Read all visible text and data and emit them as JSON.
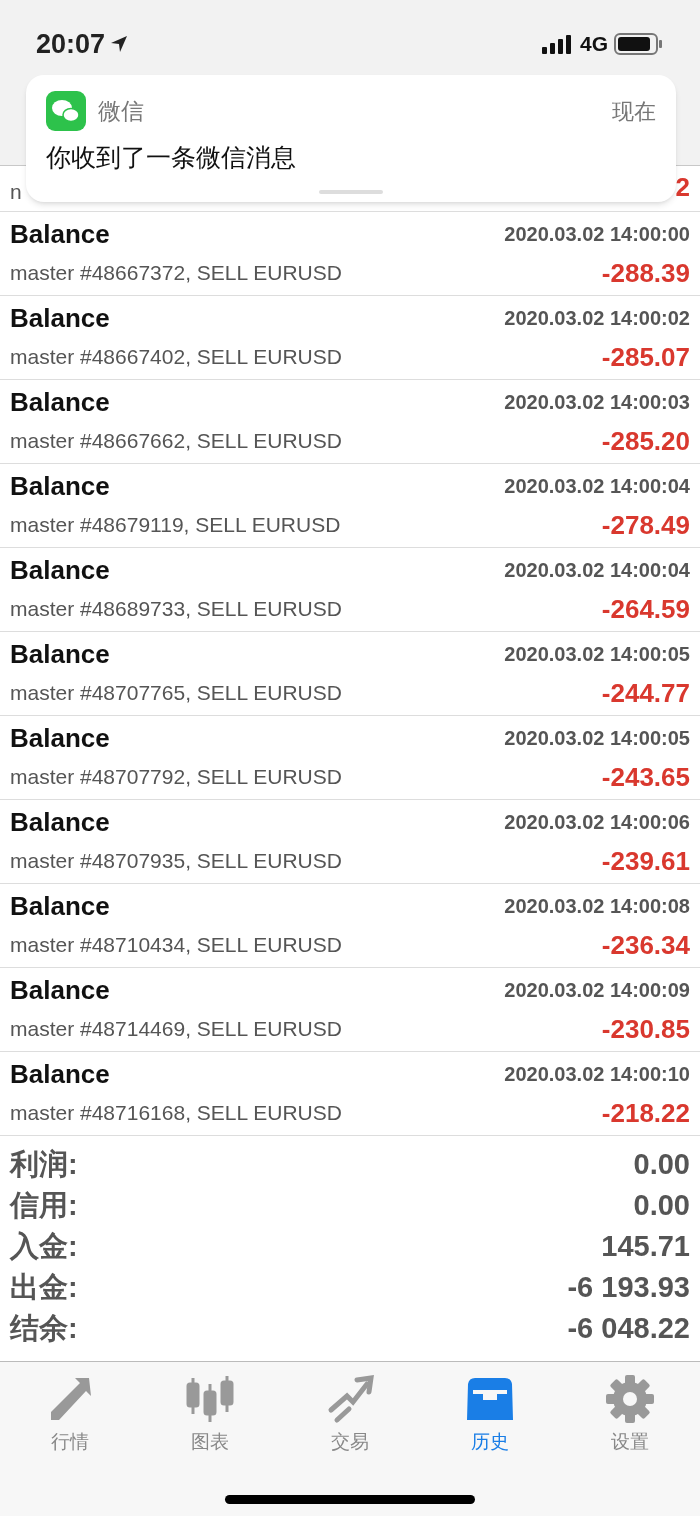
{
  "status_bar": {
    "time": "20:07",
    "network": "4G"
  },
  "notification": {
    "app": "微信",
    "time": "现在",
    "message": "你收到了一条微信消息"
  },
  "partial_row": {
    "description": "n",
    "amount": "2"
  },
  "transactions": [
    {
      "type": "Balance",
      "date": "2020.03.02 14:00:00",
      "description": "master #48667372, SELL EURUSD",
      "amount": "-288.39"
    },
    {
      "type": "Balance",
      "date": "2020.03.02 14:00:02",
      "description": "master #48667402, SELL EURUSD",
      "amount": "-285.07"
    },
    {
      "type": "Balance",
      "date": "2020.03.02 14:00:03",
      "description": "master #48667662, SELL EURUSD",
      "amount": "-285.20"
    },
    {
      "type": "Balance",
      "date": "2020.03.02 14:00:04",
      "description": "master #48679119, SELL EURUSD",
      "amount": "-278.49"
    },
    {
      "type": "Balance",
      "date": "2020.03.02 14:00:04",
      "description": "master #48689733, SELL EURUSD",
      "amount": "-264.59"
    },
    {
      "type": "Balance",
      "date": "2020.03.02 14:00:05",
      "description": "master #48707765, SELL EURUSD",
      "amount": "-244.77"
    },
    {
      "type": "Balance",
      "date": "2020.03.02 14:00:05",
      "description": "master #48707792, SELL EURUSD",
      "amount": "-243.65"
    },
    {
      "type": "Balance",
      "date": "2020.03.02 14:00:06",
      "description": "master #48707935, SELL EURUSD",
      "amount": "-239.61"
    },
    {
      "type": "Balance",
      "date": "2020.03.02 14:00:08",
      "description": "master #48710434, SELL EURUSD",
      "amount": "-236.34"
    },
    {
      "type": "Balance",
      "date": "2020.03.02 14:00:09",
      "description": "master #48714469, SELL EURUSD",
      "amount": "-230.85"
    },
    {
      "type": "Balance",
      "date": "2020.03.02 14:00:10",
      "description": "master #48716168, SELL EURUSD",
      "amount": "-218.22"
    }
  ],
  "summary": [
    {
      "label": "利润:",
      "value": "0.00"
    },
    {
      "label": "信用:",
      "value": "0.00"
    },
    {
      "label": "入金:",
      "value": "145.71"
    },
    {
      "label": "出金:",
      "value": "-6 193.93"
    },
    {
      "label": "结余:",
      "value": "-6 048.22"
    }
  ],
  "tabs": [
    {
      "kind": "quotes",
      "label": "行情",
      "selected": false
    },
    {
      "kind": "chart",
      "label": "图表",
      "selected": false
    },
    {
      "kind": "trade",
      "label": "交易",
      "selected": false
    },
    {
      "kind": "history",
      "label": "历史",
      "selected": true
    },
    {
      "kind": "settings",
      "label": "设置",
      "selected": false
    }
  ]
}
